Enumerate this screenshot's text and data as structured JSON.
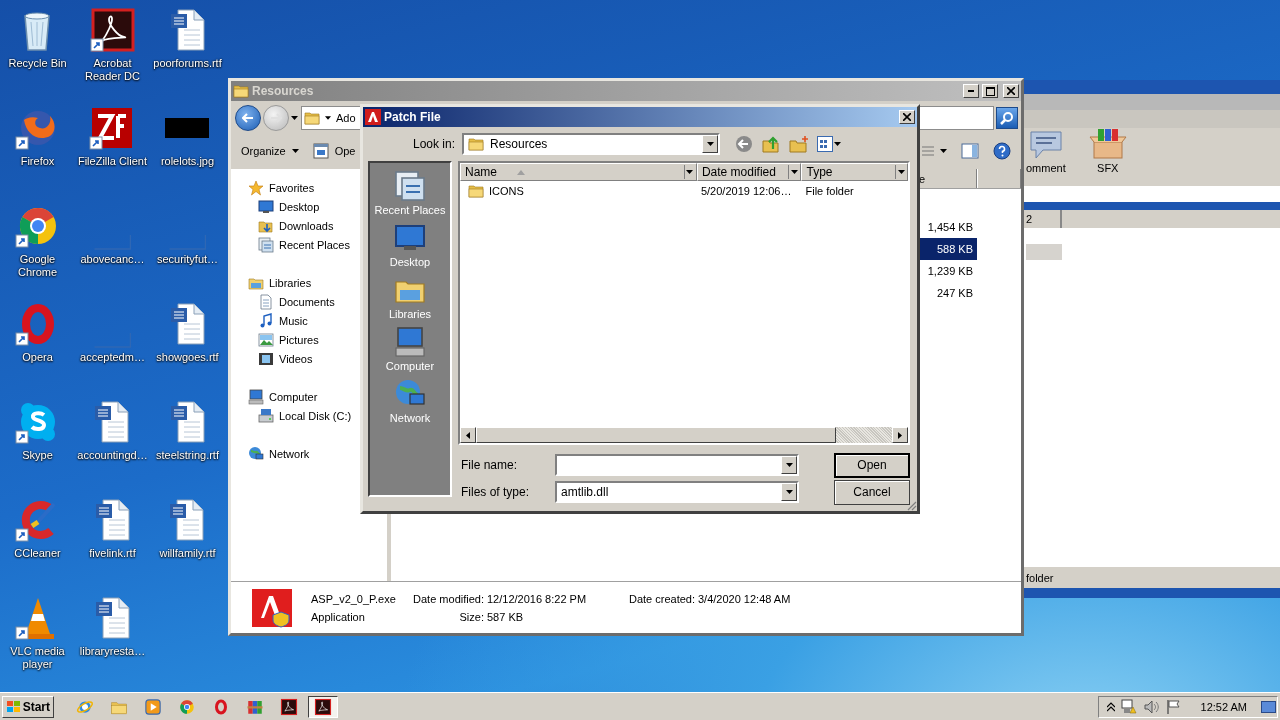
{
  "desktop": {
    "icons": [
      {
        "label": "Recycle Bin",
        "kind": "recycle",
        "shortcut": false
      },
      {
        "label": "Firefox",
        "kind": "firefox",
        "shortcut": true
      },
      {
        "label": "Google Chrome",
        "kind": "chrome",
        "shortcut": true
      },
      {
        "label": "Opera",
        "kind": "opera",
        "shortcut": true
      },
      {
        "label": "Skype",
        "kind": "skype",
        "shortcut": true
      },
      {
        "label": "CCleaner",
        "kind": "ccleaner",
        "shortcut": true
      },
      {
        "label": "VLC media player",
        "kind": "vlc",
        "shortcut": true
      },
      {
        "label": "Acrobat Reader DC",
        "kind": "acrobat",
        "shortcut": true
      },
      {
        "label": "FileZilla Client",
        "kind": "filezilla",
        "shortcut": true
      },
      {
        "label": "abovecanc…",
        "kind": "blank",
        "shortcut": false
      },
      {
        "label": "acceptedm…",
        "kind": "blank",
        "shortcut": false
      },
      {
        "label": "accountingd…",
        "kind": "word",
        "shortcut": false
      },
      {
        "label": "fivelink.rtf",
        "kind": "word",
        "shortcut": false
      },
      {
        "label": "libraryresta…",
        "kind": "word",
        "shortcut": false
      },
      {
        "label": "poorforums.rtf",
        "kind": "word",
        "shortcut": false
      },
      {
        "label": "rolelots.jpg",
        "kind": "image",
        "shortcut": false
      },
      {
        "label": "securityfut…",
        "kind": "blank",
        "shortcut": false
      },
      {
        "label": "showgoes.rtf",
        "kind": "word",
        "shortcut": false
      },
      {
        "label": "steelstring.rtf",
        "kind": "word",
        "shortcut": false
      },
      {
        "label": "willfamily.rtf",
        "kind": "word",
        "shortcut": false
      }
    ]
  },
  "background_window": {
    "toolbar": [
      {
        "label": "omment",
        "kind": "comment"
      },
      {
        "label": "SFX",
        "kind": "archive"
      }
    ],
    "column_header": "2",
    "status": "folder"
  },
  "explorer": {
    "title": "Resources",
    "address": "Ado",
    "toolbar": [
      {
        "label": "Organize",
        "kind": "menu"
      },
      {
        "label": "Ope",
        "kind": "open"
      }
    ],
    "nav": [
      {
        "label": "Favorites",
        "kind": "star",
        "children": [
          {
            "label": "Desktop",
            "kind": "desktop"
          },
          {
            "label": "Downloads",
            "kind": "downloads"
          },
          {
            "label": "Recent Places",
            "kind": "recent"
          }
        ]
      },
      {
        "label": "Libraries",
        "kind": "library",
        "children": [
          {
            "label": "Documents",
            "kind": "documents"
          },
          {
            "label": "Music",
            "kind": "music"
          },
          {
            "label": "Pictures",
            "kind": "pictures"
          },
          {
            "label": "Videos",
            "kind": "videos"
          }
        ]
      },
      {
        "label": "Computer",
        "kind": "computer",
        "children": [
          {
            "label": "Local Disk (C:)",
            "kind": "disk"
          }
        ]
      },
      {
        "label": "Network",
        "kind": "network"
      }
    ],
    "column": "e",
    "sizes": [
      {
        "text": "1,454 KB",
        "selected": false
      },
      {
        "text": "588 KB",
        "selected": true
      },
      {
        "text": "1,239 KB",
        "selected": false
      },
      {
        "text": "247 KB",
        "selected": false
      }
    ],
    "details": {
      "name": "ASP_v2_0_P.exe",
      "type": "Application",
      "modified": {
        "label": "Date modified:",
        "value": "12/12/2016 8:22 PM"
      },
      "created": {
        "label": "Date created:",
        "value": "3/4/2020 12:48 AM"
      },
      "size": {
        "label": "Size:",
        "value": "587 KB"
      }
    }
  },
  "dialog": {
    "title": "Patch File",
    "look_in_label": "Look in:",
    "look_in": "Resources",
    "places": [
      {
        "label": "Recent Places",
        "kind": "recent"
      },
      {
        "label": "Desktop",
        "kind": "desktop"
      },
      {
        "label": "Libraries",
        "kind": "library"
      },
      {
        "label": "Computer",
        "kind": "computer"
      },
      {
        "label": "Network",
        "kind": "network"
      }
    ],
    "columns": [
      {
        "label": "Name",
        "sorted": true
      },
      {
        "label": "Date modified",
        "sorted": false
      },
      {
        "label": "Type",
        "sorted": false
      }
    ],
    "files": [
      {
        "name": "ICONS",
        "date": "5/20/2019 12:06…",
        "type": "File folder"
      }
    ],
    "file_name_label": "File name:",
    "file_type_label": "Files of type:",
    "file_type": "amtlib.dll",
    "buttons": [
      {
        "label": "Open",
        "default": true
      },
      {
        "label": "Cancel",
        "default": false
      }
    ]
  },
  "taskbar": {
    "start": "Start",
    "apps": [
      {
        "kind": "ie",
        "selected": false
      },
      {
        "kind": "explorer",
        "selected": false
      },
      {
        "kind": "media",
        "selected": false
      },
      {
        "kind": "chrome",
        "selected": false
      },
      {
        "kind": "opera",
        "selected": false
      },
      {
        "kind": "winrar",
        "selected": false
      },
      {
        "kind": "acrobat",
        "selected": false
      },
      {
        "kind": "acrobat",
        "selected": true
      }
    ],
    "clock": "12:52 AM"
  }
}
